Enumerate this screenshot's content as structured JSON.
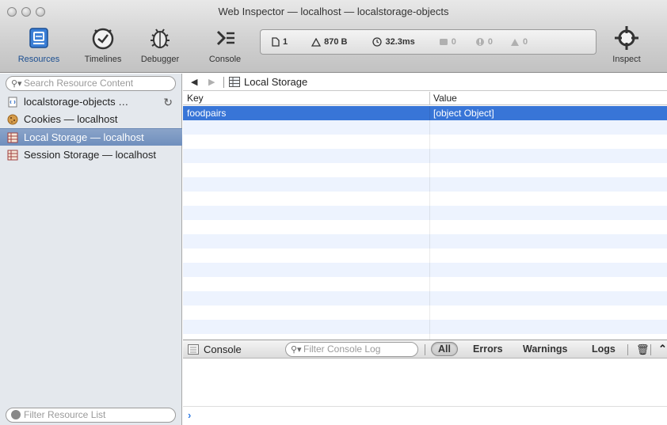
{
  "window": {
    "title": "Web Inspector — localhost — localstorage-objects"
  },
  "toolbar": {
    "tabs": [
      {
        "label": "Resources",
        "icon": "resources-icon",
        "active": true
      },
      {
        "label": "Timelines",
        "icon": "timelines-icon",
        "active": false
      },
      {
        "label": "Debugger",
        "icon": "debugger-icon",
        "active": false
      }
    ],
    "console_label": "Console",
    "inspect_label": "Inspect",
    "activity": {
      "resources_count": "1",
      "size": "870 B",
      "load_time": "32.3ms",
      "logs": "0",
      "errors": "0",
      "warnings": "0"
    }
  },
  "sidebar": {
    "search_placeholder": "Search Resource Content",
    "items": [
      {
        "label": "localstorage-objects …",
        "icon": "document-icon"
      },
      {
        "label": "Cookies — localhost",
        "icon": "cookie-icon"
      },
      {
        "label": "Local Storage — localhost",
        "icon": "storage-grid-icon",
        "selected": true
      },
      {
        "label": "Session Storage — localhost",
        "icon": "storage-grid-icon"
      }
    ],
    "filter_placeholder": "Filter Resource List"
  },
  "content": {
    "breadcrumb": "Local Storage",
    "columns": {
      "key": "Key",
      "value": "Value"
    },
    "rows": [
      {
        "key": "foodpairs",
        "value": "[object Object]",
        "selected": true
      }
    ]
  },
  "console": {
    "title": "Console",
    "filter_placeholder": "Filter Console Log",
    "scopes": [
      "All",
      "Errors",
      "Warnings",
      "Logs"
    ],
    "prompt": "›"
  },
  "colors": {
    "selection": "#3875d7",
    "sidebar_selection": "#7894c2",
    "accent_blue": "#1c5aa8"
  }
}
